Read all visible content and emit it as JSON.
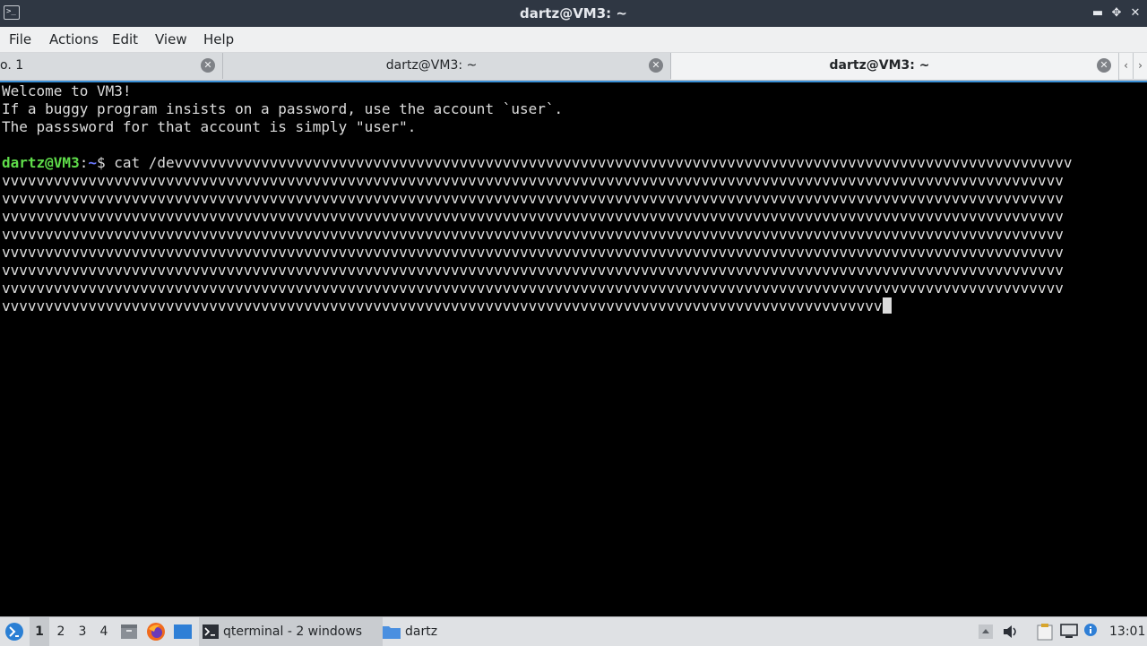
{
  "window": {
    "title": "dartz@VM3: ~",
    "prompt_icon": ">_",
    "minimize_icon": "▬",
    "maximize_icon": "✥",
    "close_icon": "✕"
  },
  "menu": {
    "items": [
      "File",
      "Actions",
      "Edit",
      "View",
      "Help"
    ]
  },
  "tabs": [
    {
      "label": "o. 1",
      "active": false
    },
    {
      "label": "dartz@VM3: ~",
      "active": false
    },
    {
      "label": "dartz@VM3: ~",
      "active": true
    }
  ],
  "terminal": {
    "welcome": [
      "Welcome to VM3!",
      "If a buggy program insists on a password, use the account `user`.",
      "The passsword for that account is simply \"user\"."
    ],
    "prompt_user": "dartz@VM3",
    "prompt_sep": ":",
    "prompt_path": "~",
    "prompt_symbol": "$ ",
    "command_start": "cat /devvvvvvvvvvvvvvvvvvvvvvvvvvvvvvvvvvvvvvvvvvvvvvvvvvvvvvvvvvvvvvvvvvvvvvvvvvvvvvvvvvvvvvvvvvvvvvvvvvvvvvvv",
    "wrap_lines": [
      "vvvvvvvvvvvvvvvvvvvvvvvvvvvvvvvvvvvvvvvvvvvvvvvvvvvvvvvvvvvvvvvvvvvvvvvvvvvvvvvvvvvvvvvvvvvvvvvvvvvvvvvvvvvvvvvvvvvvvvvvvvv",
      "vvvvvvvvvvvvvvvvvvvvvvvvvvvvvvvvvvvvvvvvvvvvvvvvvvvvvvvvvvvvvvvvvvvvvvvvvvvvvvvvvvvvvvvvvvvvvvvvvvvvvvvvvvvvvvvvvvvvvvvvvvv",
      "vvvvvvvvvvvvvvvvvvvvvvvvvvvvvvvvvvvvvvvvvvvvvvvvvvvvvvvvvvvvvvvvvvvvvvvvvvvvvvvvvvvvvvvvvvvvvvvvvvvvvvvvvvvvvvvvvvvvvvvvvvv",
      "vvvvvvvvvvvvvvvvvvvvvvvvvvvvvvvvvvvvvvvvvvvvvvvvvvvvvvvvvvvvvvvvvvvvvvvvvvvvvvvvvvvvvvvvvvvvvvvvvvvvvvvvvvvvvvvvvvvvvvvvvvv",
      "vvvvvvvvvvvvvvvvvvvvvvvvvvvvvvvvvvvvvvvvvvvvvvvvvvvvvvvvvvvvvvvvvvvvvvvvvvvvvvvvvvvvvvvvvvvvvvvvvvvvvvvvvvvvvvvvvvvvvvvvvvv",
      "vvvvvvvvvvvvvvvvvvvvvvvvvvvvvvvvvvvvvvvvvvvvvvvvvvvvvvvvvvvvvvvvvvvvvvvvvvvvvvvvvvvvvvvvvvvvvvvvvvvvvvvvvvvvvvvvvvvvvvvvvvv",
      "vvvvvvvvvvvvvvvvvvvvvvvvvvvvvvvvvvvvvvvvvvvvvvvvvvvvvvvvvvvvvvvvvvvvvvvvvvvvvvvvvvvvvvvvvvvvvvvvvvvvvvvvvvvvvvvvvvvvvvvvvvv"
    ],
    "last_line": "vvvvvvvvvvvvvvvvvvvvvvvvvvvvvvvvvvvvvvvvvvvvvvvvvvvvvvvvvvvvvvvvvvvvvvvvvvvvvvvvvvvvvvvvvvvvvvvvvvvvvv"
  },
  "taskbar": {
    "desktops": [
      "1",
      "2",
      "3",
      "4"
    ],
    "active_desktop": "1",
    "tasks": [
      {
        "label": "qterminal - 2 windows",
        "icon": "terminal-icon",
        "active": true
      },
      {
        "label": "dartz",
        "icon": "folder-icon",
        "active": false
      }
    ],
    "clock": "13:01",
    "colors": {
      "accent": "#3a8fd6",
      "folder": "#4a8fe0",
      "firefox": "#f06a1d"
    }
  }
}
